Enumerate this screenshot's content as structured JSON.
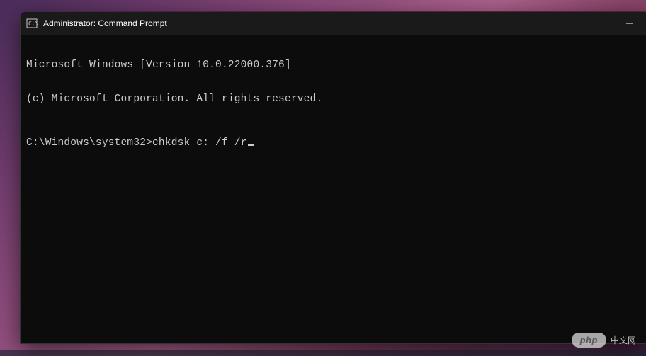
{
  "titlebar": {
    "title": "Administrator: Command Prompt"
  },
  "terminal": {
    "line1": "Microsoft Windows [Version 10.0.22000.376]",
    "line2": "(c) Microsoft Corporation. All rights reserved.",
    "prompt": "C:\\Windows\\system32>",
    "command": "chkdsk c: /f /r"
  },
  "watermark": {
    "badge": "php",
    "text": "中文网"
  }
}
